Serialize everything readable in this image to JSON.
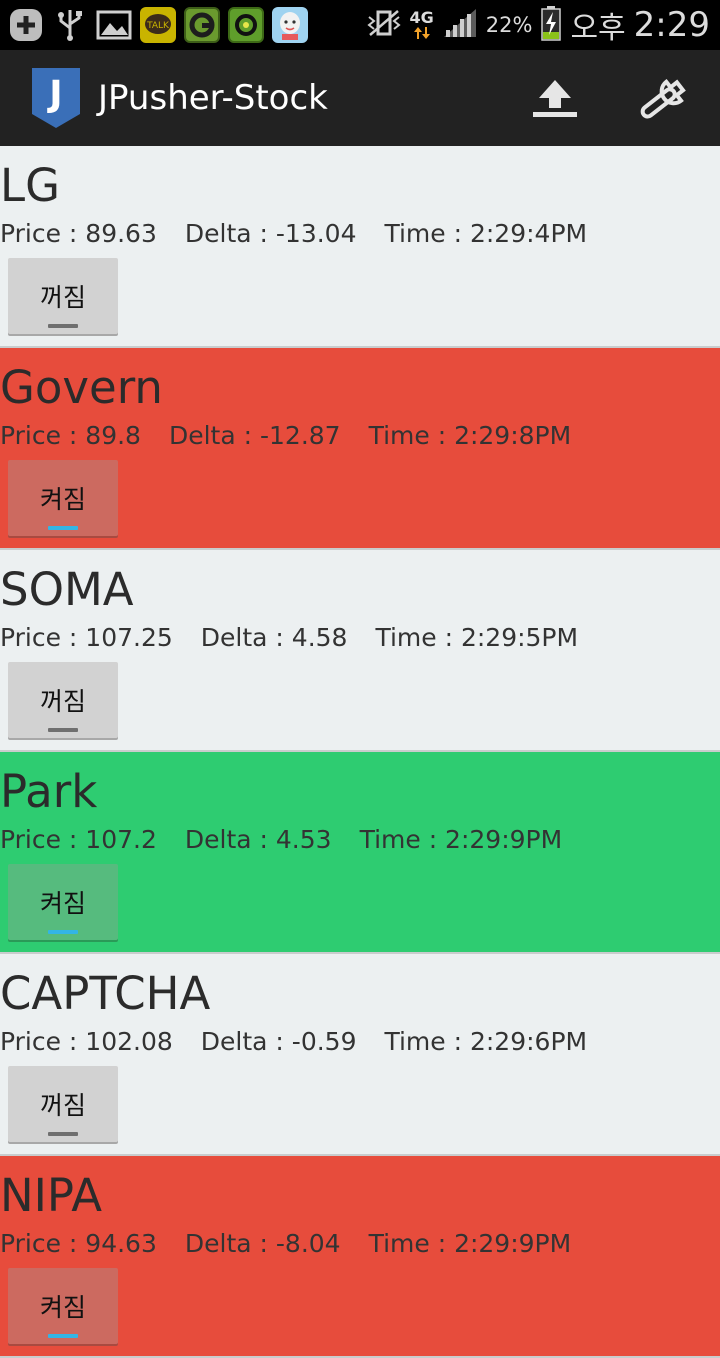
{
  "status_bar": {
    "battery": "22%",
    "network": "4G",
    "ampm": "오후",
    "time": "2:29",
    "icons": [
      "plus-icon",
      "usb-icon",
      "image-icon",
      "kakaotalk-icon",
      "google-icon",
      "app-icon",
      "face-icon"
    ]
  },
  "app": {
    "title": "JPusher-Stock",
    "logo_letter": "J"
  },
  "colors": {
    "neutral": "#ecf0f1",
    "down": "#e74c3c",
    "up": "#2ecc71",
    "actionbar": "#222222"
  },
  "stocks": [
    {
      "name": "LG",
      "price_label": "Price : 89.63",
      "delta_label": "Delta : -13.04",
      "time_label": "Time : 2:29:4PM",
      "toggle": "꺼짐",
      "state": "off",
      "trend": "neutral"
    },
    {
      "name": "Govern",
      "price_label": "Price : 89.8",
      "delta_label": "Delta : -12.87",
      "time_label": "Time : 2:29:8PM",
      "toggle": "켜짐",
      "state": "on",
      "trend": "down"
    },
    {
      "name": "SOMA",
      "price_label": "Price : 107.25",
      "delta_label": "Delta : 4.58",
      "time_label": "Time : 2:29:5PM",
      "toggle": "꺼짐",
      "state": "off",
      "trend": "neutral"
    },
    {
      "name": "Park",
      "price_label": "Price : 107.2",
      "delta_label": "Delta : 4.53",
      "time_label": "Time : 2:29:9PM",
      "toggle": "켜짐",
      "state": "on",
      "trend": "up"
    },
    {
      "name": "CAPTCHA",
      "price_label": "Price : 102.08",
      "delta_label": "Delta : -0.59",
      "time_label": "Time : 2:29:6PM",
      "toggle": "꺼짐",
      "state": "off",
      "trend": "neutral"
    },
    {
      "name": "NIPA",
      "price_label": "Price : 94.63",
      "delta_label": "Delta : -8.04",
      "time_label": "Time : 2:29:9PM",
      "toggle": "켜짐",
      "state": "on",
      "trend": "down"
    }
  ]
}
